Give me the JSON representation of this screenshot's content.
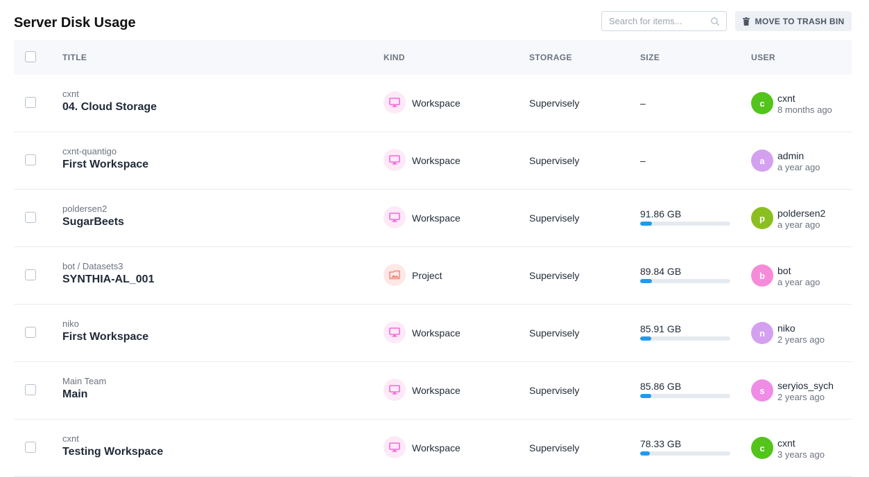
{
  "page": {
    "title": "Server Disk Usage"
  },
  "search": {
    "placeholder": "Search for items..."
  },
  "toolbar": {
    "trash_label": "MOVE TO TRASH BIN"
  },
  "table": {
    "columns": [
      "TITLE",
      "KIND",
      "STORAGE",
      "SIZE",
      "USER"
    ],
    "rows": [
      {
        "team": "cxnt",
        "name": "04. Cloud Storage",
        "kind": "Workspace",
        "kind_icon": "monitor-icon",
        "storage": "Supervisely",
        "size": "–",
        "usage": null,
        "user": "cxnt",
        "user_initial": "c",
        "avatar_color": "#52c41a",
        "time": "8 months ago"
      },
      {
        "team": "cxnt-quantigo",
        "name": "First Workspace",
        "kind": "Workspace",
        "kind_icon": "monitor-icon",
        "storage": "Supervisely",
        "size": "–",
        "usage": null,
        "user": "admin",
        "user_initial": "a",
        "avatar_color": "#d4a0f0",
        "time": "a year ago"
      },
      {
        "team": "poldersen2",
        "name": "SugarBeets",
        "kind": "Workspace",
        "kind_icon": "monitor-icon",
        "storage": "Supervisely",
        "size": "91.86 GB",
        "usage": 0.13,
        "user": "poldersen2",
        "user_initial": "p",
        "avatar_color": "#8bbf1f",
        "time": "a year ago"
      },
      {
        "team": "bot / Datasets3",
        "name": "SYNTHIA-AL_001",
        "kind": "Project",
        "kind_icon": "image-folder-icon",
        "storage": "Supervisely",
        "size": "89.84 GB",
        "usage": 0.13,
        "user": "bot",
        "user_initial": "b",
        "avatar_color": "#f58bd9",
        "time": "a year ago"
      },
      {
        "team": "niko",
        "name": "First Workspace",
        "kind": "Workspace",
        "kind_icon": "monitor-icon",
        "storage": "Supervisely",
        "size": "85.91 GB",
        "usage": 0.12,
        "user": "niko",
        "user_initial": "n",
        "avatar_color": "#d4a0f0",
        "time": "2 years ago"
      },
      {
        "team": "Main Team",
        "name": "Main",
        "kind": "Workspace",
        "kind_icon": "monitor-icon",
        "storage": "Supervisely",
        "size": "85.86 GB",
        "usage": 0.12,
        "user": "seryios_sych",
        "user_initial": "s",
        "avatar_color": "#ee8ce6",
        "time": "2 years ago"
      },
      {
        "team": "cxnt",
        "name": "Testing Workspace",
        "kind": "Workspace",
        "kind_icon": "monitor-icon",
        "storage": "Supervisely",
        "size": "78.33 GB",
        "usage": 0.11,
        "user": "cxnt",
        "user_initial": "c",
        "avatar_color": "#52c41a",
        "time": "3 years ago"
      }
    ]
  },
  "colors": {
    "accent": "#1e9bf0",
    "workspace_icon": "#f06ad8",
    "project_icon": "#f0857a"
  }
}
